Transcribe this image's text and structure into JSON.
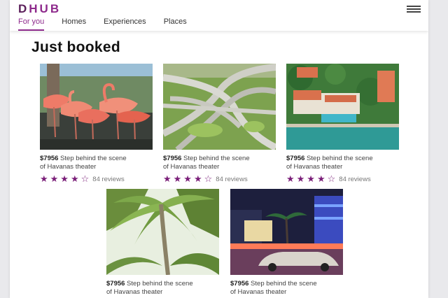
{
  "app": {
    "logo_first": "D",
    "logo_rest": "HUB",
    "accent_color": "#8e2a8c"
  },
  "nav": {
    "tabs": [
      {
        "label": "For you",
        "active": true
      },
      {
        "label": "Homes",
        "active": false
      },
      {
        "label": "Experiences",
        "active": false
      },
      {
        "label": "Places",
        "active": false
      }
    ],
    "menu_icon": "hamburger-menu-icon"
  },
  "section": {
    "title": "Just booked"
  },
  "cards": [
    {
      "price": "$7956",
      "text_line1": " Step behind the scene",
      "text_line2": "of Havanas theater",
      "rating": 4,
      "stars_full": "★★★★",
      "stars_empty": "☆",
      "reviews": "84 reviews",
      "image": "flamingos"
    },
    {
      "price": "$7956",
      "text_line1": " Step behind the scene",
      "text_line2": "of Havanas theater",
      "rating": 4,
      "stars_full": "★★★★",
      "stars_empty": "☆",
      "reviews": "84 reviews",
      "image": "highway-interchange"
    },
    {
      "price": "$7956",
      "text_line1": " Step behind the scene",
      "text_line2": "of Havanas theater",
      "rating": 4,
      "stars_full": "★★★★",
      "stars_empty": "☆",
      "reviews": "84 reviews",
      "image": "villa-waterfront"
    },
    {
      "price": "$7956",
      "text_line1": " Step behind the scene",
      "text_line2": "of Havanas theater",
      "image": "palm-trees"
    },
    {
      "price": "$7956",
      "text_line1": " Step behind the scene",
      "text_line2": "of Havanas theater",
      "image": "night-street-car"
    }
  ]
}
